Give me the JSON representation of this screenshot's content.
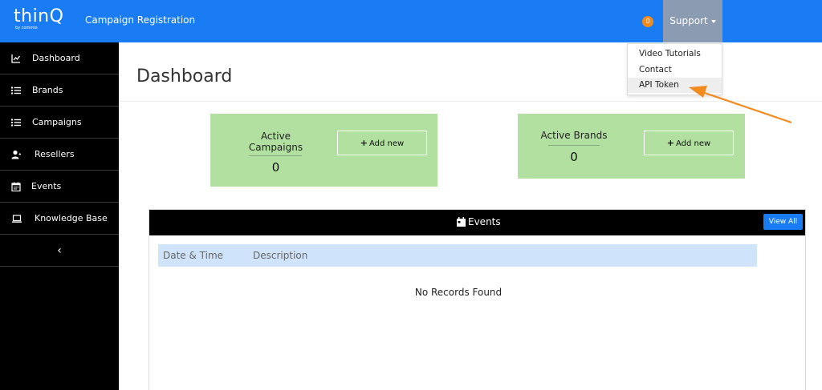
{
  "header": {
    "logo_text": "thinQ",
    "logo_sub": "by commio",
    "app_title": "Campaign Registration",
    "notification_count": "0",
    "support_label": "Support"
  },
  "support_menu": {
    "items": [
      {
        "label": "Video Tutorials"
      },
      {
        "label": "Contact"
      },
      {
        "label": "API Token"
      }
    ]
  },
  "sidebar": {
    "items": [
      {
        "label": "Dashboard",
        "icon": "chart-icon"
      },
      {
        "label": "Brands",
        "icon": "list-icon"
      },
      {
        "label": "Campaigns",
        "icon": "list-icon"
      },
      {
        "label": "Resellers",
        "icon": "users-icon"
      },
      {
        "label": "Events",
        "icon": "calendar-icon"
      },
      {
        "label": "Knowledge Base",
        "icon": "laptop-icon"
      }
    ],
    "collapse_label": "‹"
  },
  "main": {
    "page_title": "Dashboard",
    "cards": [
      {
        "title_line1": "Active",
        "title_line2": "Campaigns",
        "value": "0",
        "add_label": "Add new"
      },
      {
        "title_line1": "Active Brands",
        "value": "0",
        "add_label": "Add new"
      }
    ],
    "events": {
      "title": "Events",
      "view_all_label": "View All",
      "columns": [
        "Date & Time",
        "Description"
      ],
      "empty_text": "No Records Found"
    }
  },
  "colors": {
    "topbar": "#1a7cf5",
    "sidebar": "#000000",
    "card": "#b2e0a0",
    "support_active": "#8a9bb2",
    "badge": "#f28a1e",
    "annotation_arrow": "#f28a1e",
    "table_header": "#cfe3fb"
  }
}
